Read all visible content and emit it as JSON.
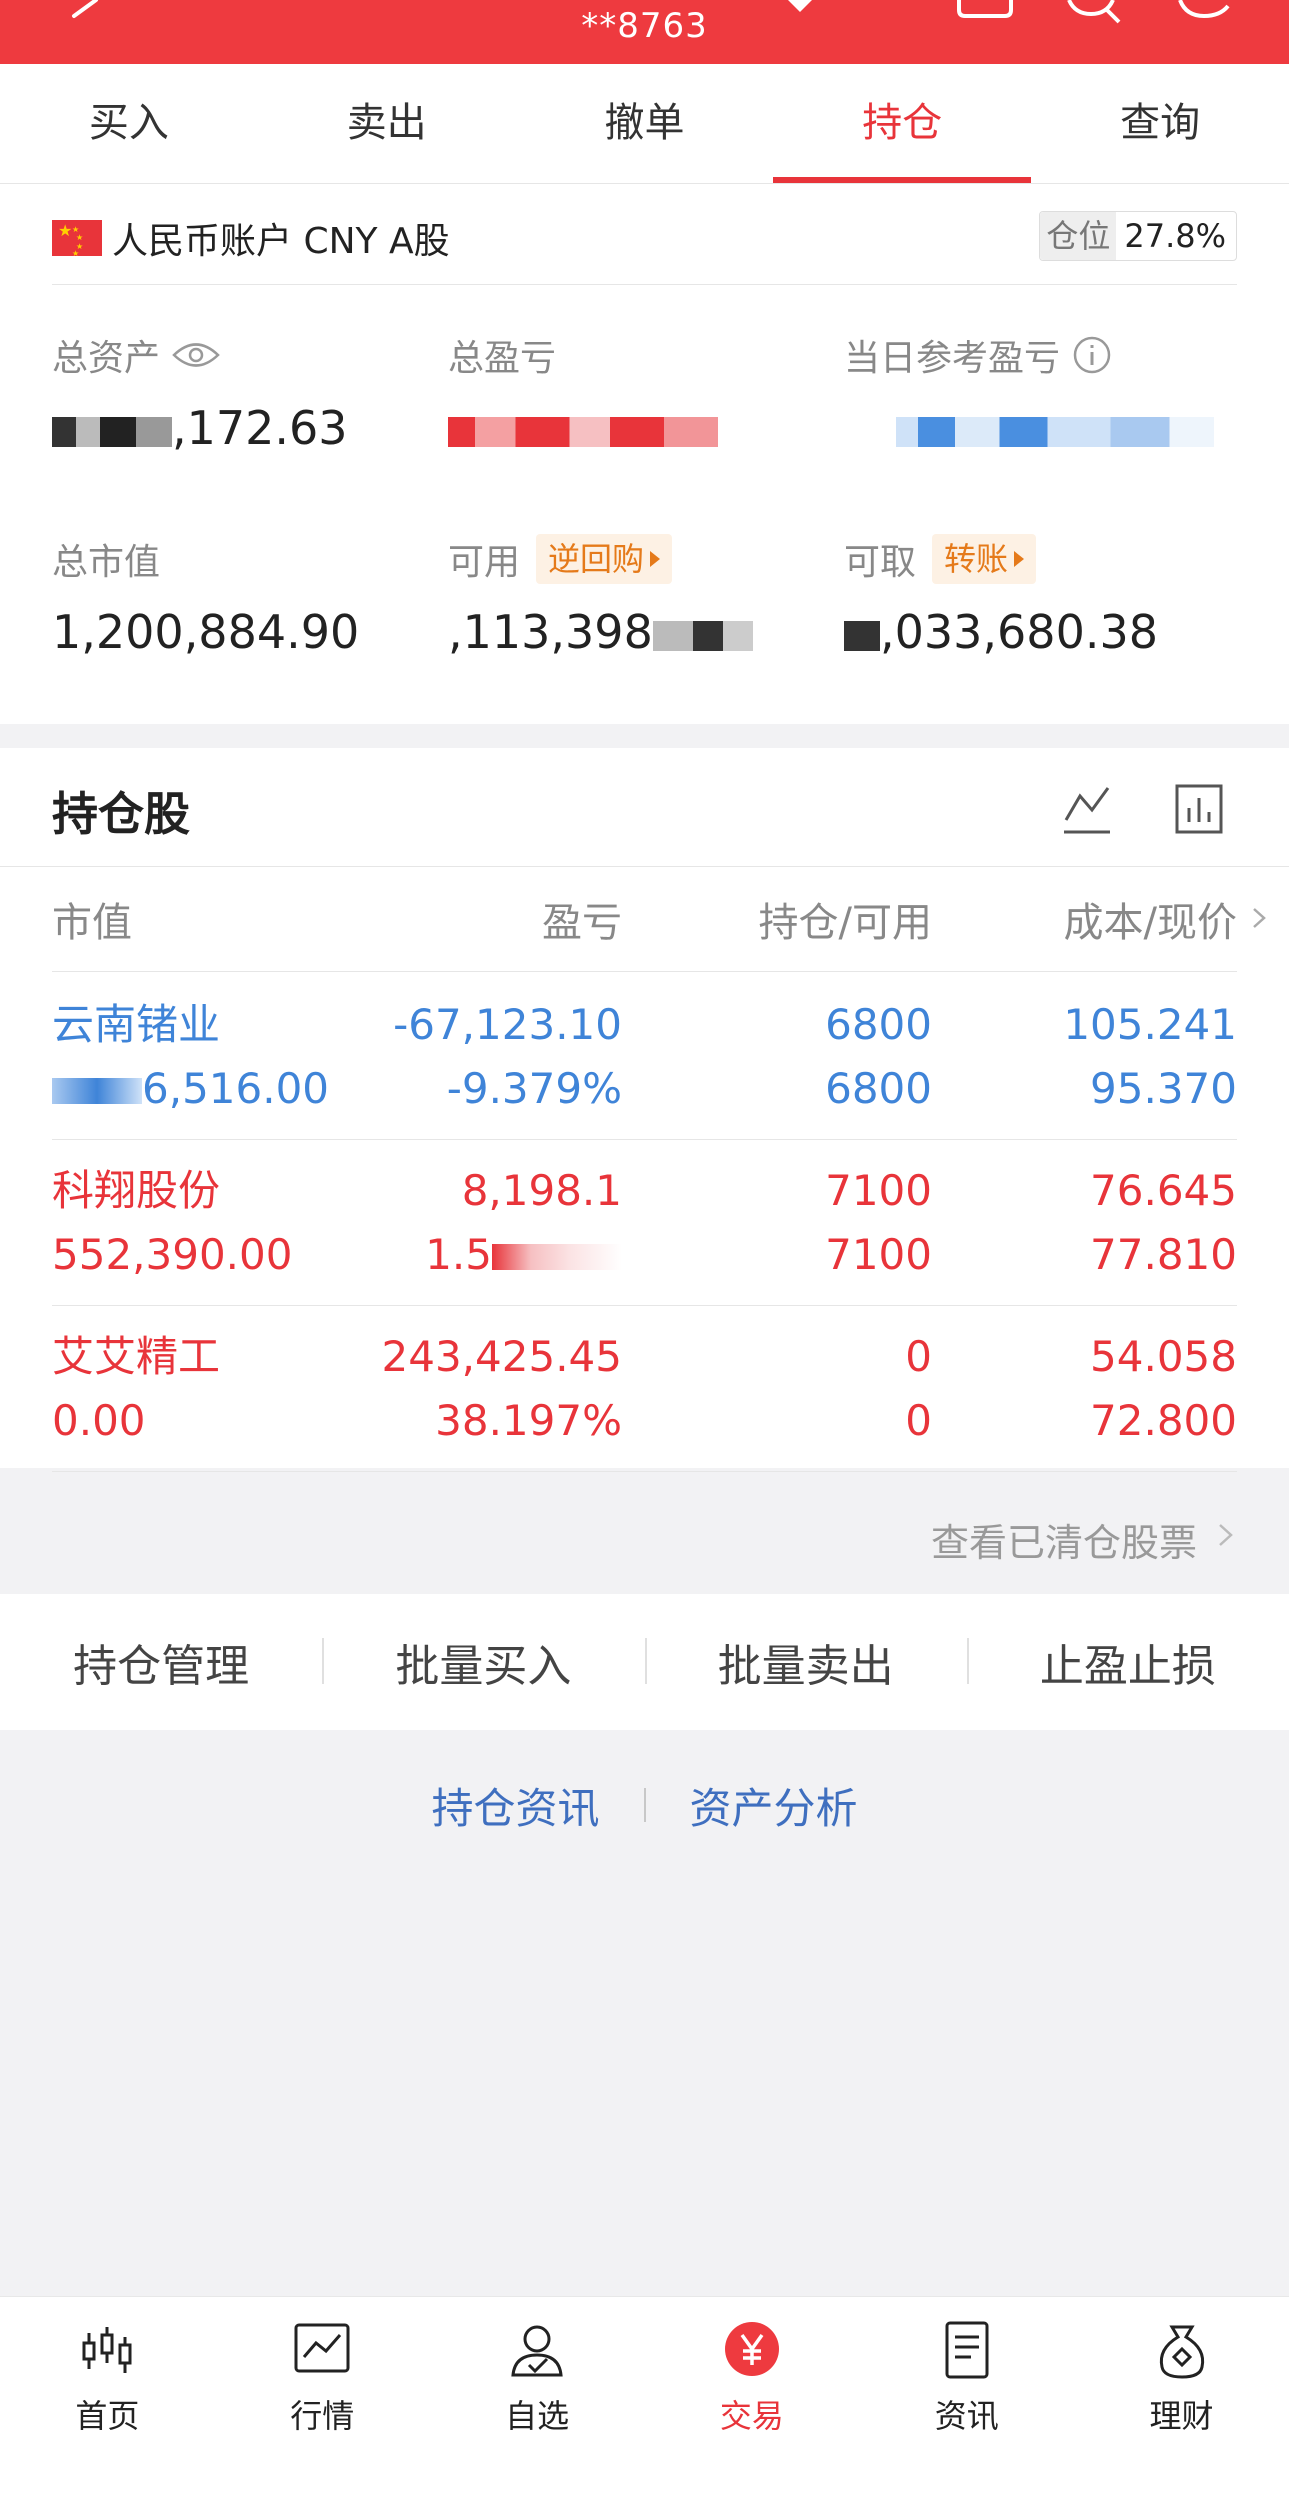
{
  "header": {
    "account_masked": "**8763"
  },
  "tabs": [
    {
      "label": "买入"
    },
    {
      "label": "卖出"
    },
    {
      "label": "撤单"
    },
    {
      "label": "持仓",
      "active": true
    },
    {
      "label": "查询"
    }
  ],
  "account": {
    "title": "人民币账户 CNY A股",
    "position_label": "仓位",
    "position_value": "27.8%",
    "total_assets": {
      "label": "总资产",
      "value": ",172.63"
    },
    "total_pnl": {
      "label": "总盈亏",
      "value": ""
    },
    "daily_pnl": {
      "label": "当日参考盈亏",
      "value": ""
    },
    "market_value": {
      "label": "总市值",
      "value": "1,200,884.90"
    },
    "available": {
      "label": "可用",
      "tag": "逆回购",
      "value": ",113,398"
    },
    "withdrawable": {
      "label": "可取",
      "tag": "转账",
      "value": ",033,680.38"
    }
  },
  "holdings": {
    "title": "持仓股",
    "columns": [
      "市值",
      "盈亏",
      "持仓/可用",
      "成本/现价"
    ],
    "rows": [
      {
        "name": "云南锗业",
        "market_value": "6,516.00",
        "pnl": "-67,123.10",
        "pnl_pct": "-9.379%",
        "position": "6800",
        "available": "6800",
        "cost": "105.241",
        "price": "95.370",
        "color": "blue"
      },
      {
        "name": "科翔股份",
        "market_value": "552,390.00",
        "pnl": "8,198.1",
        "pnl_pct": "1.5",
        "position": "7100",
        "available": "7100",
        "cost": "76.645",
        "price": "77.810",
        "color": "red"
      },
      {
        "name": "艾艾精工",
        "market_value": "0.00",
        "pnl": "243,425.45",
        "pnl_pct": "38.197%",
        "position": "0",
        "available": "0",
        "cost": "54.058",
        "price": "72.800",
        "color": "red"
      }
    ],
    "cleared_link": "查看已清仓股票"
  },
  "actions": [
    "持仓管理",
    "批量买入",
    "批量卖出",
    "止盈止损"
  ],
  "links": [
    "持仓资讯",
    "资产分析"
  ],
  "bottom_nav": [
    {
      "label": "首页",
      "icon": "candlestick-icon"
    },
    {
      "label": "行情",
      "icon": "chart-icon"
    },
    {
      "label": "自选",
      "icon": "user-check-icon"
    },
    {
      "label": "交易",
      "icon": "yen-icon",
      "active": true
    },
    {
      "label": "资讯",
      "icon": "document-icon"
    },
    {
      "label": "理财",
      "icon": "money-bag-icon"
    }
  ],
  "colors": {
    "brand_red": "#ee3a3f",
    "up_red": "#e8343a",
    "down_blue": "#3f84d8",
    "tag_orange": "#e57a1a",
    "link_blue": "#3f6fbf"
  }
}
